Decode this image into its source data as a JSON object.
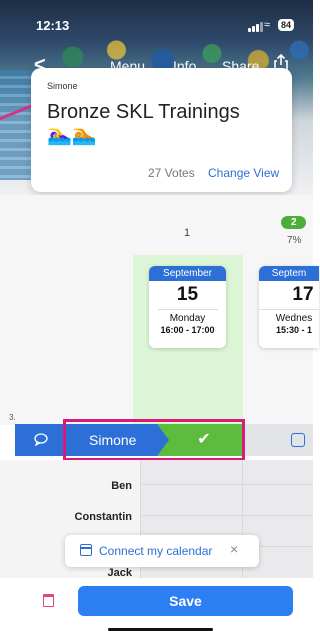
{
  "status_bar": {
    "time": "12:13",
    "battery": "84"
  },
  "navbar": {
    "back": "<",
    "menu": "Menu",
    "info": "Info",
    "share": "Share"
  },
  "poll": {
    "author": "Simone",
    "title": "Bronze SKL Trainings 🏊‍♀️🏊",
    "votes": "27 Votes",
    "change_view": "Change View"
  },
  "columns": [
    {
      "number": "1",
      "month": "September",
      "day": "15",
      "weekday": "Monday",
      "time": "16:00 - 17:00"
    },
    {
      "number": "",
      "month": "Septem",
      "day": "17",
      "weekday": "Wednes",
      "time": "15:30 - 1",
      "badge": "2",
      "percent": "7%"
    }
  ],
  "vote_row": {
    "rank": "3.",
    "name": "Simone",
    "check": "✔"
  },
  "participants": [
    "Ben",
    "Constantin",
    "Jack"
  ],
  "calendar_prompt": {
    "label": "Connect my calendar",
    "close": "×"
  },
  "footer": {
    "save": "Save"
  },
  "colors": {
    "accent": "#2c6fd6",
    "yes": "#5dbb3e",
    "highlight": "#d81b7a"
  }
}
